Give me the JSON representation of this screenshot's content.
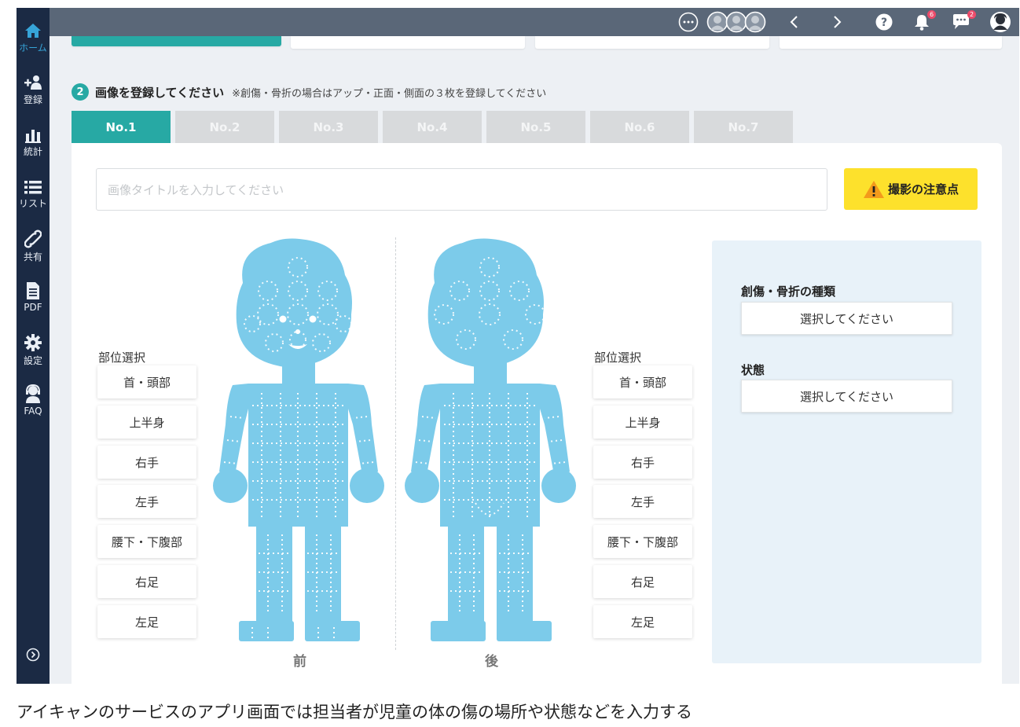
{
  "sidebar": {
    "items": [
      {
        "label": "ホーム",
        "icon": "home-icon"
      },
      {
        "label": "登録",
        "icon": "add-user-icon"
      },
      {
        "label": "統計",
        "icon": "bar-chart-icon"
      },
      {
        "label": "リスト",
        "icon": "list-icon"
      },
      {
        "label": "共有",
        "icon": "link-icon"
      },
      {
        "label": "PDF",
        "icon": "document-icon"
      },
      {
        "label": "設定",
        "icon": "gear-icon"
      },
      {
        "label": "FAQ",
        "icon": "support-icon"
      }
    ],
    "expand_icon": "chevron-right-circle-icon"
  },
  "topbar": {
    "notifications_count": "6",
    "messages_count": "2"
  },
  "step": {
    "number": "2",
    "title": "画像を登録してください",
    "note": "※創傷・骨折の場合はアップ・正面・側面の３枚を登録してください"
  },
  "tabs": [
    "No.1",
    "No.2",
    "No.3",
    "No.4",
    "No.5",
    "No.6",
    "No.7"
  ],
  "active_tab": "No.1",
  "image_title": {
    "placeholder": "画像タイトルを入力してください"
  },
  "caution_button": "撮影の注意点",
  "front": {
    "section_label": "部位選択",
    "parts": [
      "首・頭部",
      "上半身",
      "右手",
      "左手",
      "腰下・下腹部",
      "右足",
      "左足"
    ],
    "caption": "前"
  },
  "back": {
    "section_label": "部位選択",
    "parts": [
      "首・頭部",
      "上半身",
      "右手",
      "左手",
      "腰下・下腹部",
      "右足",
      "左足"
    ],
    "caption": "後"
  },
  "details": {
    "injury_type_label": "創傷・骨折の種類",
    "injury_type_value": "選択してください",
    "condition_label": "状態",
    "condition_value": "選択してください"
  },
  "colors": {
    "sidebar_bg": "#1b2a44",
    "topbar_bg": "#5a6778",
    "accent_teal": "#27a9a4",
    "body_figure": "#7ccbea",
    "caution_yellow": "#fde12c"
  },
  "caption_text": "アイキャンのサービスのアプリ画面では担当者が児童の体の傷の場所や状態などを入力する"
}
